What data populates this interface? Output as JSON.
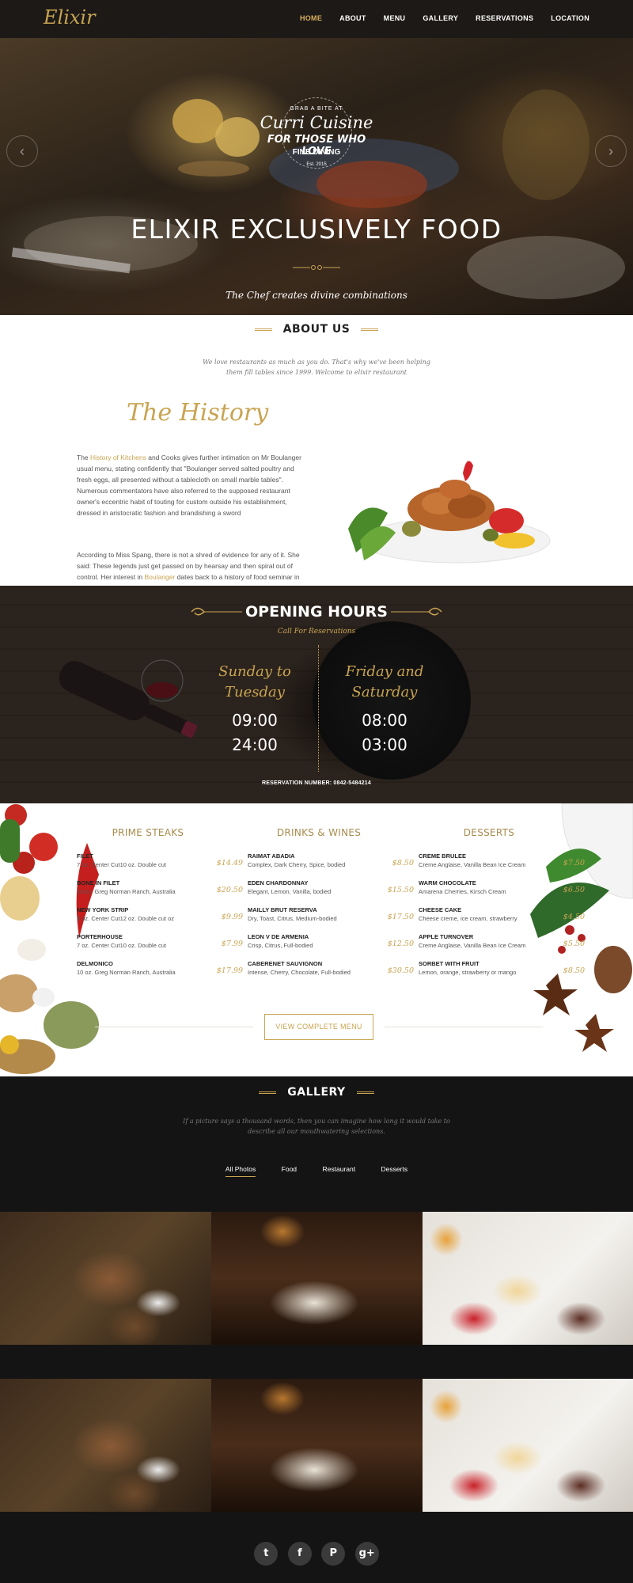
{
  "nav": {
    "logo": "Elixir",
    "items": [
      {
        "label": "HOME",
        "active": true
      },
      {
        "label": "ABOUT"
      },
      {
        "label": "MENU"
      },
      {
        "label": "GALLERY"
      },
      {
        "label": "RESERVATIONS"
      },
      {
        "label": "LOCATION"
      }
    ]
  },
  "hero": {
    "badge_top": "GRAB A BITE AT",
    "badge_script": "Curri Cuisine",
    "badge_line1": "FOR THOSE WHO LOVE",
    "badge_line2": "FINE DINING",
    "badge_est": "Est. 2015",
    "title": "ELIXIR EXCLUSIVELY FOOD",
    "subtitle": "The Chef creates divine combinations",
    "prev_icon": "chevron-left-icon",
    "next_icon": "chevron-right-icon"
  },
  "about": {
    "title": "ABOUT US",
    "intro": "We love restaurants as much as you do. That's why we've been helping them fill tables since 1999. Welcome to elixir restaurant",
    "history_title": "The History",
    "p1_a": "The ",
    "p1_link": "History of Kitchens",
    "p1_b": " and Cooks gives further intimation on Mr Boulanger usual menu, stating confidently that \"Boulanger served salted poultry and fresh eggs, all presented without a tablecloth on small marble tables\". Numerous commentators have also referred to the supposed restaurant owner's eccentric habit of touting for custom outside his establishment, dressed in aristocratic fashion and brandishing a sword",
    "p2_a": "According to Miss Spang, there is not a shred of evidence for any of it. She said: These legends just get passed on by hearsay and then spiral out of control. Her interest in ",
    "p2_link": "Boulanger",
    "p2_b": " dates back to a history of food seminar in"
  },
  "hours": {
    "title": "OPENING HOURS",
    "subtitle": "Call For Reservations",
    "left_days": "Sunday to Tuesday",
    "left_open": "09:00",
    "left_close": "24:00",
    "right_days": "Friday and Saturday",
    "right_open": "08:00",
    "right_close": "03:00",
    "reservation": "RESERVATION NUMBER: 0842-5484214"
  },
  "menu": {
    "columns": [
      {
        "title": "PRIME STEAKS",
        "items": [
          {
            "name": "FILET",
            "desc": "7 oz. Center Cut10 oz. Double cut",
            "price": "$14.49"
          },
          {
            "name": "BONE IN FILET",
            "desc": "10 oz. Greg Norman Ranch, Australia",
            "price": "$20.50"
          },
          {
            "name": "NEW YORK STRIP",
            "desc": "9 oz. Center Cut12 oz. Double cut oz",
            "price": "$9.99"
          },
          {
            "name": "PORTERHOUSE",
            "desc": "7 oz. Center Cut10 oz. Double cut",
            "price": "$7.99"
          },
          {
            "name": "DELMONICO",
            "desc": "10 oz. Greg Norman Ranch, Australia",
            "price": "$17.99"
          }
        ]
      },
      {
        "title": "DRINKS & WINES",
        "items": [
          {
            "name": "RAIMAT ABADIA",
            "desc": "Complex, Dark Cherry, Spice, bodied",
            "price": "$8.50"
          },
          {
            "name": "EDEN CHARDONNAY",
            "desc": "Elegant, Lemon, Vanilla, bodied",
            "price": "$15.50"
          },
          {
            "name": "MAILLY BRUT RESERVA",
            "desc": "Dry, Toast, Citrus, Medium-bodied",
            "price": "$17.50"
          },
          {
            "name": "LEON V DE ARMENIA",
            "desc": "Crisp, Citrus, Full-bodied",
            "price": "$12.50"
          },
          {
            "name": "CABERENET SAUVIGNON",
            "desc": "Intense, Cherry, Chocolate, Full-bodied",
            "price": "$30.50"
          }
        ]
      },
      {
        "title": "DESSERTS",
        "items": [
          {
            "name": "CREME BRULEE",
            "desc": "Creme Anglaise, Vanilla Bean Ice Cream",
            "price": "$7.50"
          },
          {
            "name": "WARM CHOCOLATE",
            "desc": "Amarena Cherries, Kirsch Cream",
            "price": "$6.50"
          },
          {
            "name": "CHEESE CAKE",
            "desc": "Cheese creme, ice cream, strawberry",
            "price": "$4.50"
          },
          {
            "name": "APPLE TURNOVER",
            "desc": "Creme Anglaise, Vanilla Bean Ice Cream",
            "price": "$5.50"
          },
          {
            "name": "SORBET WITH FRUIT",
            "desc": "Lemon, orange, strawberry or mango",
            "price": "$8.50"
          }
        ]
      }
    ],
    "button": "VIEW COMPLETE MENU"
  },
  "gallery": {
    "title": "GALLERY",
    "intro": "If a picture says a thousand words, then you can imagine how long it would take to describe all our mouthwatering selections.",
    "filters": [
      {
        "label": "All Photos",
        "active": true
      },
      {
        "label": "Food"
      },
      {
        "label": "Restaurant"
      },
      {
        "label": "Desserts"
      }
    ]
  },
  "social": [
    {
      "icon": "twitter-icon",
      "glyph": "t"
    },
    {
      "icon": "facebook-icon",
      "glyph": "f"
    },
    {
      "icon": "pinterest-icon",
      "glyph": "P"
    },
    {
      "icon": "google-plus-icon",
      "glyph": "g+"
    }
  ],
  "colors": {
    "gold": "#c9a452",
    "dark": "#151414",
    "nav": "#1c1917"
  }
}
